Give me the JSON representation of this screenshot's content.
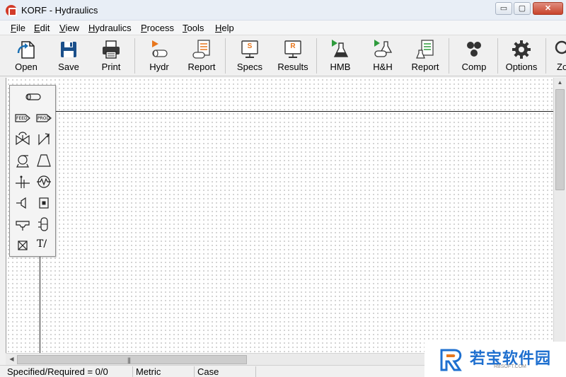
{
  "window": {
    "title": "KORF - Hydraulics",
    "minimize": "▭",
    "maximize": "▢",
    "close": "✕"
  },
  "menu": [
    {
      "label": "File",
      "accel": "F",
      "rest": "ile"
    },
    {
      "label": "Edit",
      "accel": "E",
      "rest": "dit"
    },
    {
      "label": "View",
      "accel": "V",
      "rest": "iew"
    },
    {
      "label": "Hydraulics",
      "accel": "H",
      "rest": "ydraulics"
    },
    {
      "label": "Process",
      "accel": "P",
      "rest": "rocess"
    },
    {
      "label": "Tools",
      "accel": "T",
      "rest": "ools"
    },
    {
      "label": "Help",
      "accel": "H",
      "rest": "elp"
    }
  ],
  "toolbar": {
    "open": "Open",
    "save": "Save",
    "print": "Print",
    "hydr": "Hydr",
    "report1": "Report",
    "specs": "Specs",
    "results": "Results",
    "hmb": "HMB",
    "hh": "H&H",
    "report2": "Report",
    "comp": "Comp",
    "options": "Options",
    "zoom": "Zo",
    "specs_badge": "S",
    "results_badge": "R"
  },
  "palette": {
    "text_tool": "T/",
    "items": [
      "pipe",
      "feed",
      "product",
      "valve",
      "control-valve",
      "pump",
      "compressor",
      "orifice",
      "heat-exchanger",
      "tank",
      "vessel",
      "nozzle",
      "column",
      "misc",
      "text"
    ]
  },
  "statusbar": {
    "specified": "Specified/Required = 0/0",
    "units": "Metric",
    "case": "Case"
  },
  "watermark": {
    "text": "若宝软件园",
    "sub": "RBSOFT.COM"
  },
  "colors": {
    "accent_orange": "#e8761c",
    "accent_green": "#2e9b3c",
    "save_blue": "#1a4f8a",
    "close_red": "#c8442c"
  }
}
